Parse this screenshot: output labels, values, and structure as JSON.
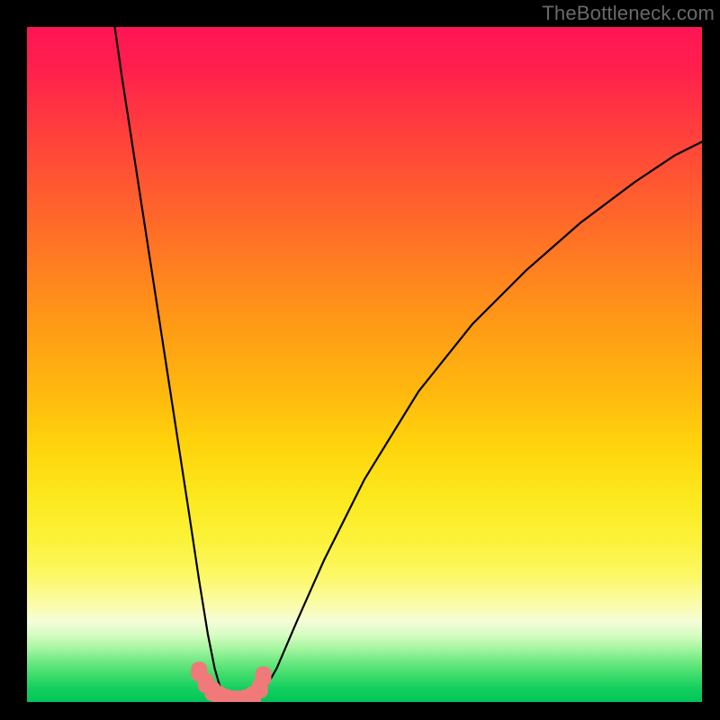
{
  "watermark": "TheBottleneck.com",
  "chart_data": {
    "type": "line",
    "title": "",
    "xlabel": "",
    "ylabel": "",
    "xlim": [
      0,
      100
    ],
    "ylim": [
      0,
      100
    ],
    "grid": false,
    "legend": false,
    "series": [
      {
        "name": "left-branch",
        "x": [
          13,
          14,
          16,
          18,
          20,
          22,
          24,
          25.5,
          26.8,
          27.8,
          28.6,
          29.3,
          29.8,
          30.1
        ],
        "y": [
          100,
          93,
          80,
          67,
          54,
          41,
          28,
          18,
          10,
          5,
          2.2,
          1.0,
          0.4,
          0.2
        ]
      },
      {
        "name": "right-branch",
        "x": [
          34,
          35,
          37,
          40,
          44,
          50,
          58,
          66,
          74,
          82,
          90,
          96,
          100
        ],
        "y": [
          0.3,
          1.5,
          5,
          12,
          21,
          33,
          46,
          56,
          64,
          71,
          77,
          81,
          83
        ]
      },
      {
        "name": "bottom-markers",
        "x": [
          25.5,
          26.5,
          27.5,
          28.5,
          29.5,
          30.5,
          31.5,
          32.5,
          33.5,
          34.5,
          35.0
        ],
        "y": [
          4.5,
          2.8,
          1.6,
          0.9,
          0.45,
          0.25,
          0.25,
          0.4,
          0.9,
          2.0,
          3.8
        ]
      }
    ],
    "gradient_bands": {
      "description": "vertical red-to-green gradient, green at bottom indicating optimal",
      "stops": [
        {
          "pos": 0.0,
          "color": "#ff1554"
        },
        {
          "pos": 0.24,
          "color": "#ff5a30"
        },
        {
          "pos": 0.54,
          "color": "#ffb80e"
        },
        {
          "pos": 0.76,
          "color": "#fbf23a"
        },
        {
          "pos": 0.9,
          "color": "#d8fcc3"
        },
        {
          "pos": 1.0,
          "color": "#00c658"
        }
      ]
    }
  }
}
